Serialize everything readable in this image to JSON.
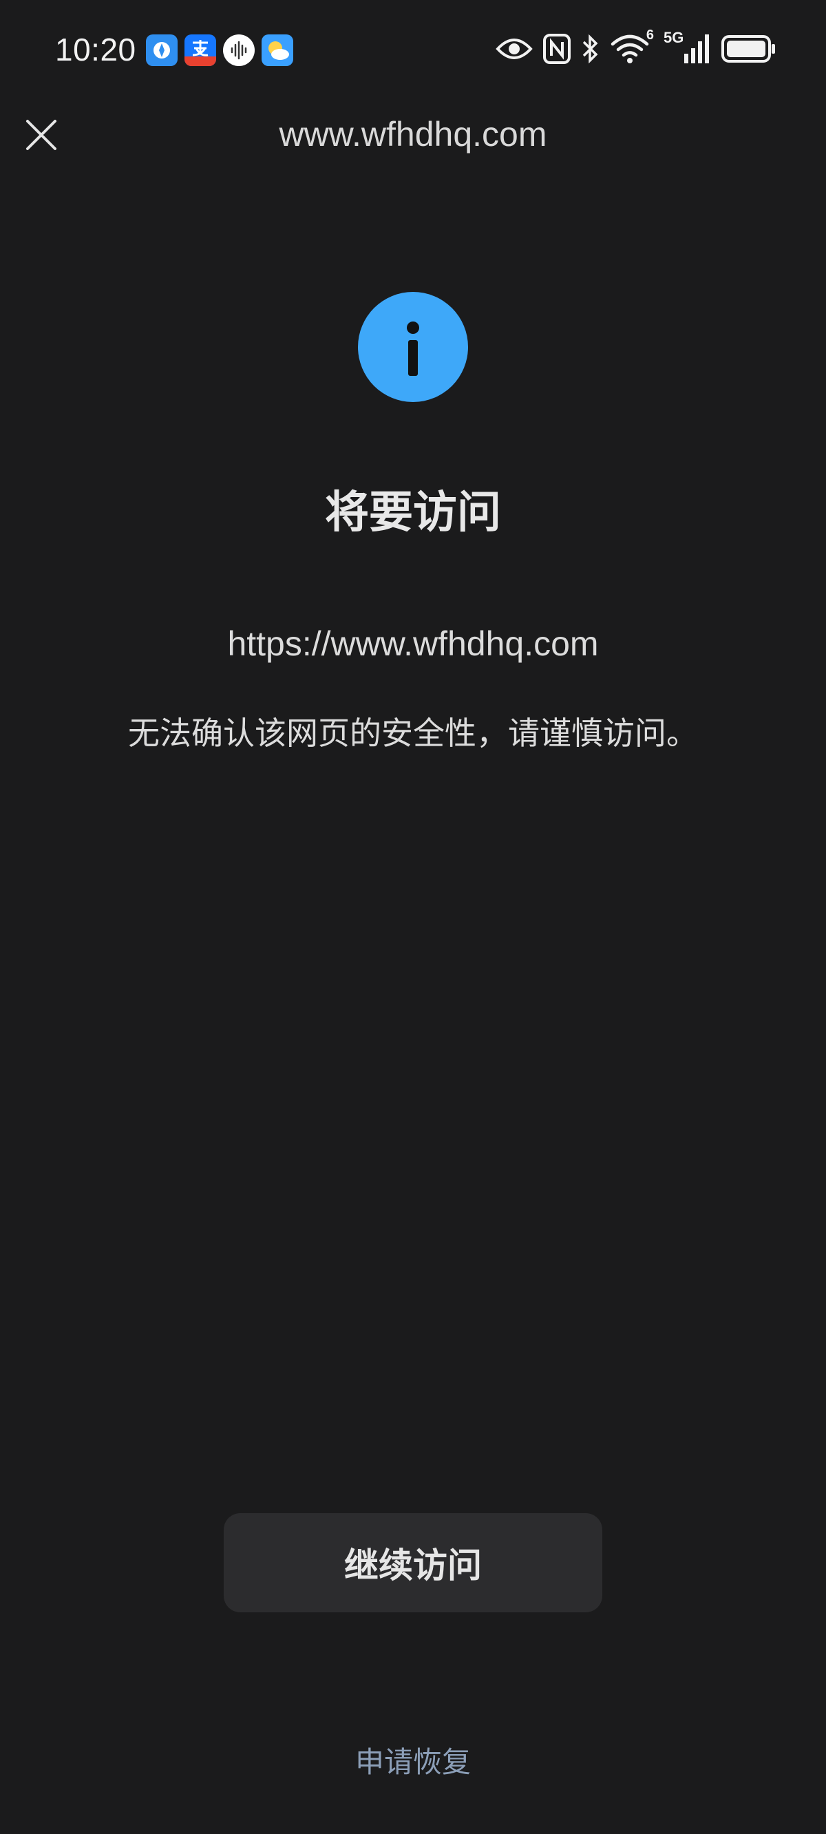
{
  "status_bar": {
    "time": "10:20",
    "notification_icons": [
      "browser-app-icon",
      "alipay-icon",
      "voice-assistant-icon",
      "weather-icon"
    ],
    "system_icons": [
      "eye-comfort-icon",
      "nfc-icon",
      "bluetooth-icon",
      "wifi-icon",
      "signal-5g-icon",
      "battery-icon"
    ],
    "wifi_badge": "6",
    "network_label": "5G"
  },
  "top_bar": {
    "title": "www.wfhdhq.com",
    "close_icon": "close-icon"
  },
  "main": {
    "icon": "info-icon",
    "icon_color": "#3ea8f9",
    "heading": "将要访问",
    "url": "https://www.wfhdhq.com",
    "warning": "无法确认该网页的安全性，请谨慎访问。"
  },
  "actions": {
    "continue_label": "继续访问",
    "restore_label": "申请恢复",
    "restore_color": "#8c9fb8"
  }
}
